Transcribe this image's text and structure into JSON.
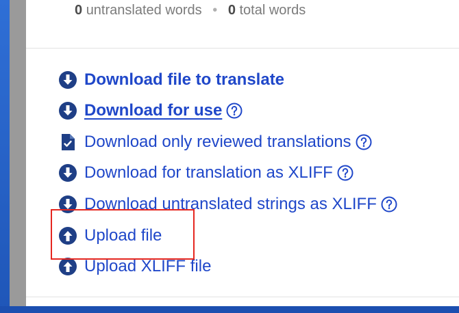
{
  "stats": {
    "untranslated_count": "0",
    "untranslated_label": "untranslated words",
    "separator": "•",
    "total_count": "0",
    "total_label": "total words"
  },
  "actions": [
    {
      "label": "Download file to translate",
      "icon": "download-circle-icon",
      "bold": true
    },
    {
      "label": "Download for use",
      "icon": "download-circle-icon",
      "bold": true,
      "help": true
    },
    {
      "label": "Download only reviewed translations",
      "icon": "document-check-icon",
      "help": true
    },
    {
      "label": "Download for translation as XLIFF",
      "icon": "download-circle-icon",
      "help": true
    },
    {
      "label": "Download untranslated strings as XLIFF",
      "icon": "download-circle-icon",
      "help": true
    },
    {
      "label": "Upload file",
      "icon": "upload-circle-icon",
      "highlighted": true
    },
    {
      "label": "Upload XLIFF file",
      "icon": "upload-circle-icon"
    }
  ],
  "colors": {
    "link": "#1f47c9",
    "highlight_border": "#e5261f",
    "background": "#2a63c4"
  }
}
